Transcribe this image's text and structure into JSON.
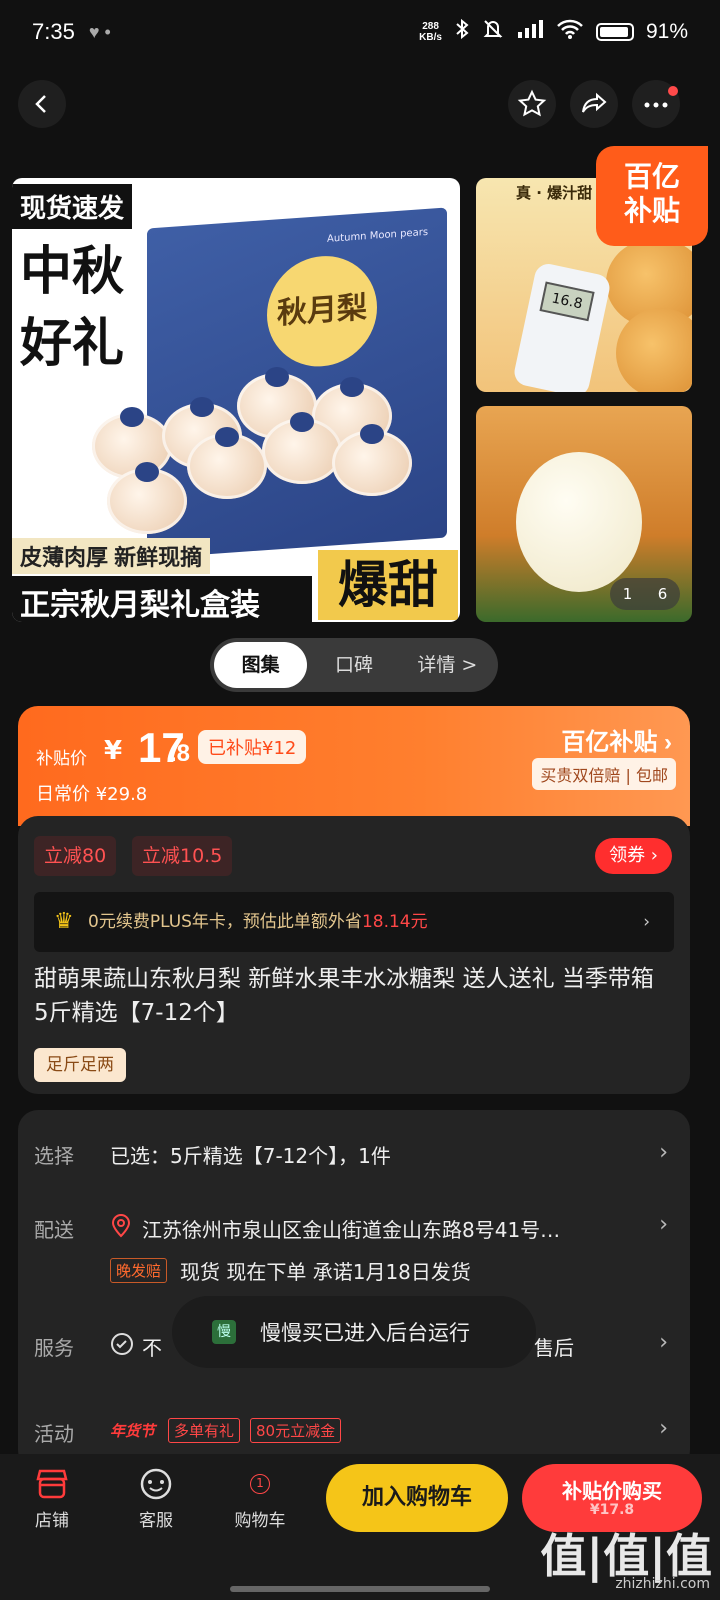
{
  "status_bar": {
    "time": "7:35",
    "dots": "♥  •",
    "net_speed_top": "288",
    "net_speed_bottom": "KB/s",
    "battery": "91%"
  },
  "gallery": {
    "main_tag": "现货速发",
    "main_calligraphy": "中秋好礼",
    "box_title": "秋月梨",
    "box_en": "Autumn Moon pears",
    "slogan_1": "皮薄肉厚 新鲜现摘",
    "slogan_2": "正宗秋月梨礼盒装",
    "slogan_3": "爆甜",
    "side_top_caption": "真 · 爆汁甜",
    "meter_reading": "16.8",
    "subsidy_badge": "百亿补贴",
    "counter_current": "1",
    "counter_total": "6"
  },
  "tabs": [
    {
      "label": "图集",
      "active": true
    },
    {
      "label": "口碑"
    },
    {
      "label": "详情 >"
    }
  ],
  "price": {
    "label": "补贴价",
    "currency": "¥",
    "integer": "17",
    "decimal": ".8",
    "subsidized": "已补贴¥12",
    "regular": "日常价 ¥29.8",
    "brand": "百亿补贴 ›",
    "perk": "买贵双倍赔 | 包邮"
  },
  "coupons": [
    "立减80",
    "立减10.5"
  ],
  "get_coupon": "领券 ›",
  "plus": {
    "prefix": "0元续费PLUS年卡，预估此单额外省",
    "amount": "18.14元",
    "arrow": "›"
  },
  "product_title": "甜萌果蔬山东秋月梨 新鲜水果丰水冰糖梨 送人送礼 当季带箱 5斤精选【7-12个】",
  "product_chip": "足斤足两",
  "rows": {
    "select_label": "选择",
    "select_value": "已选：5斤精选【7-12个】，1件",
    "ship_label": "配送",
    "ship_value": "江苏徐州市泉山区金山街道金山东路8号41号…",
    "late_badge": "晚发赔",
    "ship_detail": "现货    现在下单    承诺1月18日发货",
    "service_label": "服务",
    "service_value": "不",
    "service_after": "售后",
    "activity_label": "活动",
    "activity_brand": "年货节",
    "activity_1": "多单有礼",
    "activity_2": "80元立减金"
  },
  "toast": {
    "icon": "慢",
    "text": "慢慢买已进入后台运行"
  },
  "bottom": {
    "store": "店铺",
    "service": "客服",
    "cart": "购物车",
    "cart_count": "1",
    "add_cart": "加入购物车",
    "buy": "补贴价购买",
    "buy_sub": "¥17.8"
  },
  "watermark": "值|值|值",
  "watermark_url": "zhizhizhi.com",
  "colors": {
    "accent": "#ff6a1e",
    "cart": "#f5c518",
    "buy": "#ff3b3b"
  }
}
